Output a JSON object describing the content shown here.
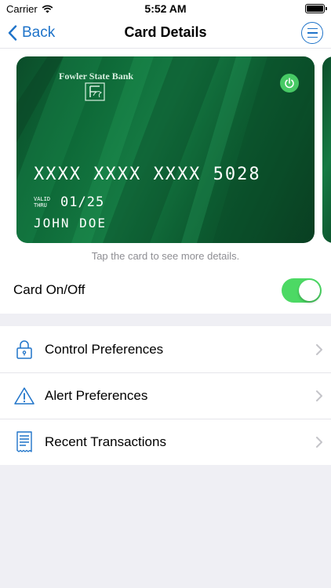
{
  "status_bar": {
    "carrier": "Carrier",
    "time": "5:52 AM"
  },
  "nav": {
    "back_label": "Back",
    "title": "Card Details"
  },
  "card": {
    "bank_name": "Fowler State Bank",
    "number": "XXXX XXXX XXXX 5028",
    "valid_thru_label": "VALID THRU",
    "expiry": "01/25",
    "holder": "JOHN DOE",
    "power_state": "on"
  },
  "card_hint": "Tap the card to see more details.",
  "card_toggle": {
    "label": "Card On/Off",
    "on": true
  },
  "menu_items": [
    {
      "label": "Control Preferences",
      "icon": "lock-icon"
    },
    {
      "label": "Alert Preferences",
      "icon": "warning-icon"
    },
    {
      "label": "Recent Transactions",
      "icon": "receipt-icon"
    }
  ],
  "colors": {
    "accent": "#1e73c9",
    "card_green": "#0e6a38",
    "toggle_on": "#4cd964",
    "power_green": "#47c965"
  }
}
